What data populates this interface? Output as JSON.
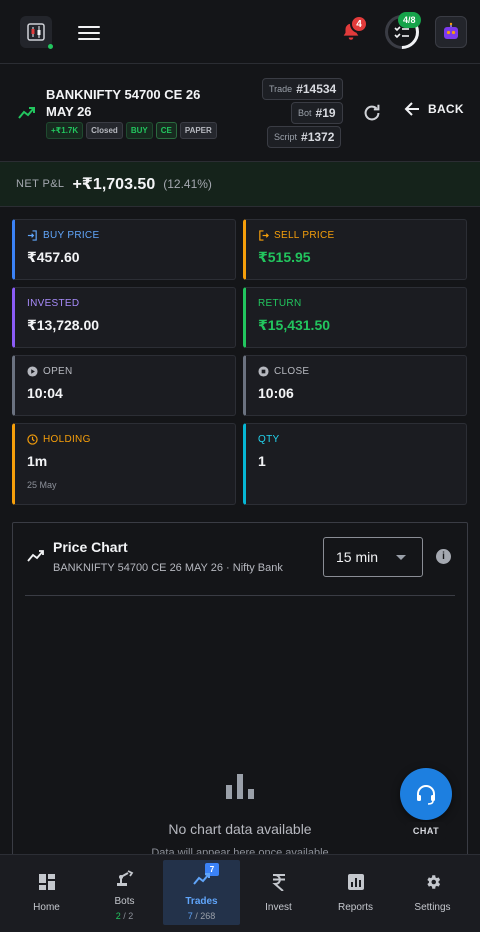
{
  "header": {
    "notification_count": "4",
    "tasks_progress": "4/8"
  },
  "trade": {
    "title": "BANKNIFTY 54700 CE 26 MAY 26",
    "tags": {
      "pnl": "+₹1.7K",
      "status": "Closed",
      "side": "BUY",
      "option_type": "CE",
      "mode": "PAPER"
    },
    "ids": {
      "trade_label": "Trade",
      "trade_id": "#14534",
      "bot_label": "Bot",
      "bot_id": "#19",
      "script_label": "Script",
      "script_id": "#1372"
    },
    "back_label": "BACK"
  },
  "net_pnl": {
    "label": "NET P&L",
    "value": "+₹1,703.50",
    "percent": "(12.41%)"
  },
  "stats": {
    "buy_price": {
      "label": "BUY PRICE",
      "value": "₹457.60"
    },
    "sell_price": {
      "label": "SELL PRICE",
      "value": "₹515.95"
    },
    "invested": {
      "label": "INVESTED",
      "value": "₹13,728.00"
    },
    "return": {
      "label": "RETURN",
      "value": "₹15,431.50"
    },
    "open": {
      "label": "OPEN",
      "value": "10:04"
    },
    "close": {
      "label": "CLOSE",
      "value": "10:06"
    },
    "holding": {
      "label": "HOLDING",
      "value": "1m",
      "sub": "25 May"
    },
    "qty": {
      "label": "QTY",
      "value": "1"
    }
  },
  "chart": {
    "title": "Price Chart",
    "subtitle": "BANKNIFTY 54700 CE 26 MAY 26 · Nifty Bank",
    "interval": "15 min",
    "info_glyph": "i",
    "empty_title": "No chart data available",
    "empty_sub": "Data will appear here once available"
  },
  "chat": {
    "label": "CHAT"
  },
  "nav": {
    "items": [
      {
        "label": "Home",
        "count": ""
      },
      {
        "label": "Bots",
        "count_active": "2",
        "count_total": "/ 2"
      },
      {
        "label": "Trades",
        "count_active": "7",
        "count_total": "/ 268",
        "badge": "7"
      },
      {
        "label": "Invest",
        "count": ""
      },
      {
        "label": "Reports",
        "count": ""
      },
      {
        "label": "Settings",
        "count": ""
      }
    ]
  },
  "colors": {
    "accent_blue": "#3b82f6",
    "profit_green": "#22c55e",
    "warning_orange": "#f59e0b",
    "invested_purple": "#8b5cf6",
    "qty_cyan": "#06b6d4",
    "alert_red": "#e23b3b"
  }
}
